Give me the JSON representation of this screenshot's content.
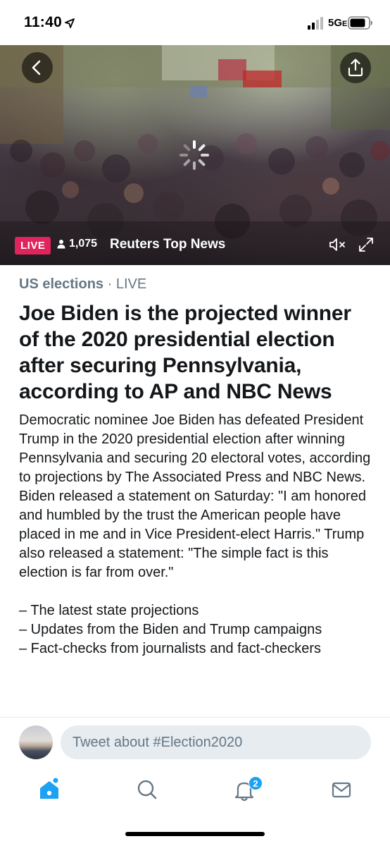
{
  "status_bar": {
    "time": "11:40",
    "network": "5G",
    "network_suffix": "E"
  },
  "video": {
    "live_label": "LIVE",
    "viewer_count": "1,075",
    "channel_name": "Reuters Top News"
  },
  "article": {
    "topic": "US elections",
    "separator": " · ",
    "status": "LIVE",
    "headline": "Joe Biden is the projected winner of the 2020 presidential election after securing Pennsylvania, according to AP and NBC News",
    "body": "Democratic nominee Joe Biden has defeated President Trump in the 2020 presidential election after winning Pennsylvania and securing 20 electoral votes, according to projections by The Associated Press and NBC News. Biden released a statement on Saturday: \"I am honored and humbled by the trust the American people have placed in me and in Vice President-elect Harris.\" Trump also released a statement: \"The simple fact is this election is far from over.\"",
    "bullets": [
      "– The latest state projections",
      "– Updates from the Biden and Trump campaigns",
      "– Fact-checks from journalists and fact-checkers"
    ]
  },
  "compose": {
    "placeholder": "Tweet about #Election2020"
  },
  "tabbar": {
    "notifications_badge": "2"
  },
  "colors": {
    "accent": "#1da1f2",
    "live_red": "#e0245e",
    "secondary_text": "#657786"
  }
}
